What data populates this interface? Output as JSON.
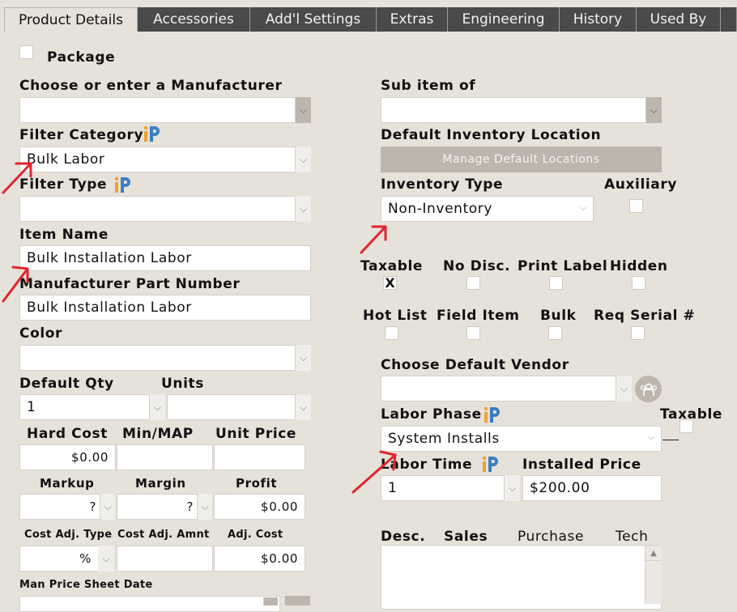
{
  "tabs": [
    "Product Details",
    "Accessories",
    "Add'l Settings",
    "Extras",
    "Engineering",
    "History",
    "Used By"
  ],
  "package": {
    "label": "Package",
    "checked": false
  },
  "left": {
    "manufacturer_label": "Choose or enter a Manufacturer",
    "manufacturer_value": "",
    "filter_category_label": "Filter Category",
    "filter_category_value": "Bulk Labor",
    "filter_type_label": "Filter Type",
    "filter_type_value": "",
    "item_name_label": "Item Name",
    "item_name_value": "Bulk Installation Labor",
    "mpn_label": "Manufacturer Part Number",
    "mpn_value": "Bulk Installation Labor",
    "color_label": "Color",
    "color_value": "",
    "default_qty_label": "Default Qty",
    "default_qty_value": "1",
    "units_label": "Units",
    "units_value": "",
    "hard_cost_label": "Hard Cost",
    "hard_cost_value": "$0.00",
    "minmap_label": "Min/MAP",
    "minmap_value": "",
    "unit_price_label": "Unit Price",
    "unit_price_value": "",
    "markup_label": "Markup",
    "markup_value": "?",
    "margin_label": "Margin",
    "margin_value": "?",
    "profit_label": "Profit",
    "profit_value": "$0.00",
    "cost_adj_type_label": "Cost Adj. Type",
    "cost_adj_type_value": "%",
    "cost_adj_amnt_label": "Cost Adj. Amnt",
    "cost_adj_amnt_value": "",
    "adj_cost_label": "Adj. Cost",
    "adj_cost_value": "$0.00",
    "man_price_sheet_label": "Man Price Sheet Date"
  },
  "right": {
    "sub_item_label": "Sub item of",
    "sub_item_value": "",
    "default_inv_loc_label": "Default Inventory Location",
    "manage_locations_button": "Manage Default Locations",
    "inventory_type_label": "Inventory Type",
    "inventory_type_value": "Non-Inventory",
    "auxiliary_label": "Auxiliary",
    "checks_row1": [
      {
        "label": "Taxable",
        "checked": true,
        "mark": "X"
      },
      {
        "label": "No Disc.",
        "checked": false,
        "mark": ""
      },
      {
        "label": "Print Label",
        "checked": false,
        "mark": ""
      },
      {
        "label": "Hidden",
        "checked": false,
        "mark": ""
      }
    ],
    "checks_row2": [
      {
        "label": "Hot List",
        "checked": false,
        "mark": ""
      },
      {
        "label": "Field Item",
        "checked": false,
        "mark": ""
      },
      {
        "label": "Bulk",
        "checked": false,
        "mark": ""
      },
      {
        "label": "Req Serial #",
        "checked": false,
        "mark": ""
      }
    ],
    "default_vendor_label": "Choose Default Vendor",
    "default_vendor_value": "",
    "labor_phase_label": "Labor Phase",
    "labor_phase_value": "System Installs",
    "taxable_label": "Taxable",
    "labor_time_label": "Labor Time",
    "labor_time_value": "1",
    "installed_price_label": "Installed Price",
    "installed_price_value": "$200.00",
    "desc_tabs": [
      "Desc.",
      "Sales",
      "Purchase",
      "Tech"
    ]
  },
  "colors": {
    "tab_dark": "#4a4a4a",
    "background": "#e6e1d9",
    "annotation_arrow": "#e0242e",
    "ip_orange": "#f0a030",
    "ip_blue": "#3a7fc4"
  }
}
